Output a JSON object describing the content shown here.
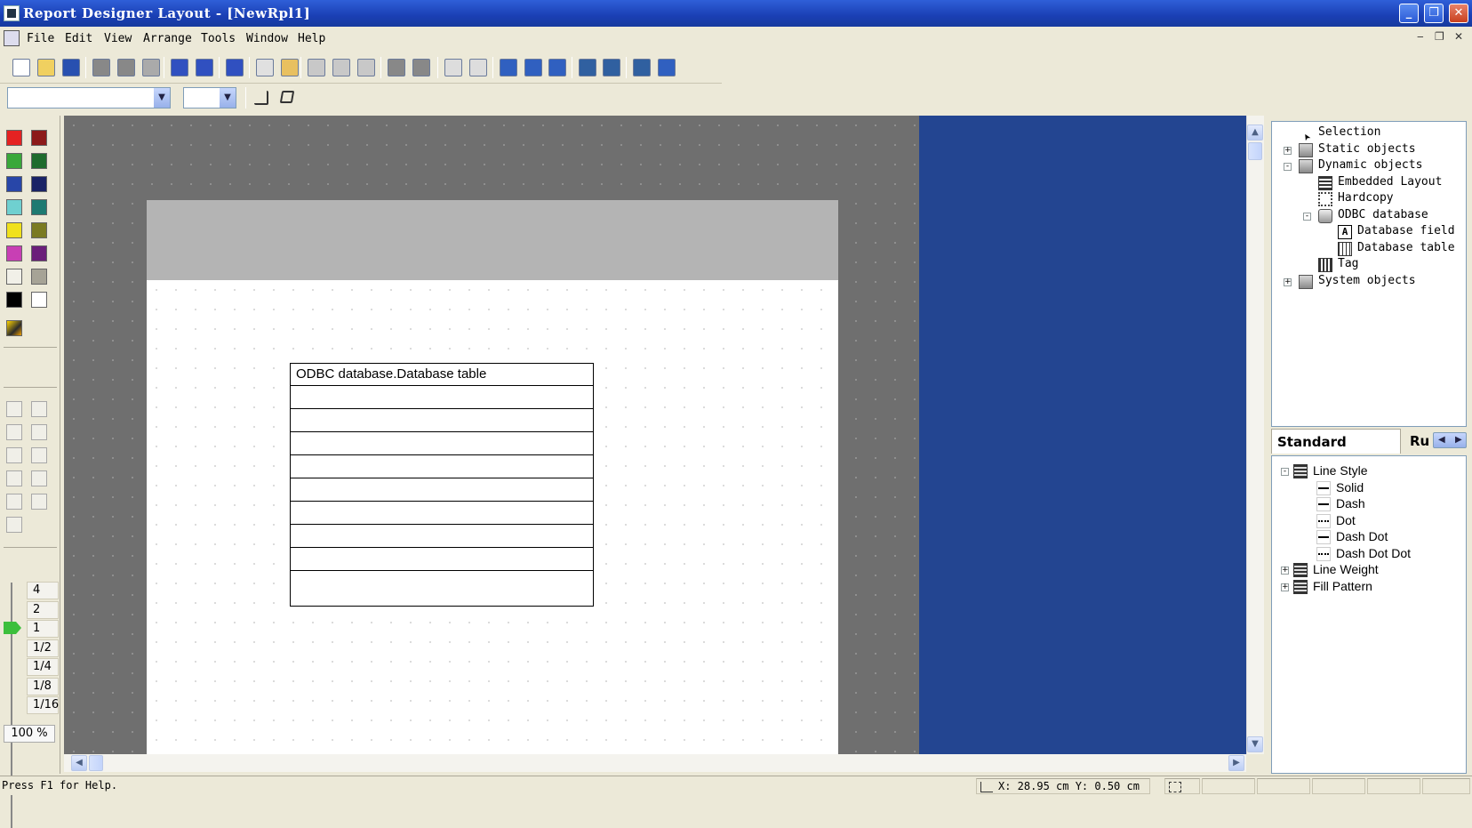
{
  "window": {
    "title": "Report Designer Layout - [NewRpl1]"
  },
  "menu": [
    "File",
    "Edit",
    "View",
    "Arrange",
    "Tools",
    "Window",
    "Help"
  ],
  "toolbar": {
    "icons": [
      "new-icon",
      "open-icon",
      "save-icon",
      "cut-icon",
      "copy-icon",
      "paste-icon",
      "undo-icon",
      "redo-icon",
      "print-icon",
      "page-icon",
      "page-setup-icon",
      "bring-front-icon",
      "send-back-icon",
      "copy-format-icon",
      "group-icon",
      "ungroup-icon",
      "grid-icon",
      "snap-icon",
      "zoom-in-icon",
      "zoom-out-icon",
      "zoom-fit-icon",
      "wizard-icon",
      "wizard2-icon",
      "properties-icon",
      "context-help-icon"
    ],
    "font_combo_value": "",
    "size_combo_value": ""
  },
  "palette": {
    "colors": [
      "#e52222",
      "#8c1a1a",
      "#3aa83a",
      "#1f6b2e",
      "#2846a8",
      "#1a2366",
      "#6fd0d0",
      "#1e7a72",
      "#f0e11c",
      "#7a7a22",
      "#c83fb4",
      "#6b1f7a",
      "#f1f0e8",
      "#a6a396",
      "#000000",
      "#ffffff"
    ]
  },
  "zoom": {
    "ticks": [
      "4",
      "2",
      "1",
      "1/2",
      "1/4",
      "1/8",
      "1/16"
    ],
    "selected": "1",
    "percent": "100 %"
  },
  "report": {
    "table_caption": "ODBC database.Database table",
    "row_count": 9
  },
  "object_tree": {
    "items": [
      {
        "label": "Selection",
        "icon": "cursor-icon"
      },
      {
        "label": "Static objects",
        "icon": "folder-icon",
        "expander": "+"
      },
      {
        "label": "Dynamic objects",
        "icon": "folder-icon",
        "expander": "-"
      },
      {
        "label": "Embedded Layout",
        "icon": "layout-icon"
      },
      {
        "label": "Hardcopy",
        "icon": "hardcopy-icon"
      },
      {
        "label": "ODBC database",
        "icon": "database-icon",
        "expander": "-"
      },
      {
        "label": "Database field",
        "icon": "field-icon"
      },
      {
        "label": "Database table",
        "icon": "table-icon"
      },
      {
        "label": "Tag",
        "icon": "tag-icon"
      },
      {
        "label": "System objects",
        "icon": "folder-icon",
        "expander": "+"
      }
    ]
  },
  "tabs": {
    "active": "Standard objects",
    "second": "Ru"
  },
  "style_tree": {
    "items": [
      {
        "label": "Line Style",
        "expander": "-"
      },
      {
        "label": "Solid"
      },
      {
        "label": "Dash"
      },
      {
        "label": "Dot"
      },
      {
        "label": "Dash Dot"
      },
      {
        "label": "Dash Dot Dot"
      },
      {
        "label": "Line Weight",
        "expander": "+"
      },
      {
        "label": "Fill Pattern",
        "expander": "+"
      }
    ]
  },
  "status": {
    "help": "Press F1 for Help.",
    "coords": "X: 28.95 cm Y: 0.50 cm"
  }
}
